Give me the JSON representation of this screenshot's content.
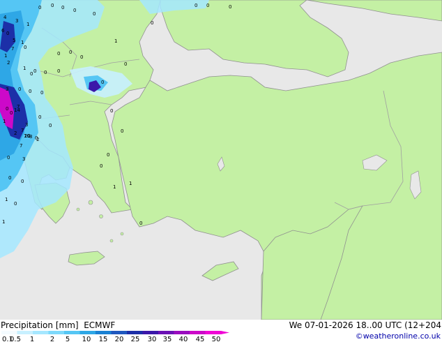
{
  "title": {
    "product": "Precipitation [mm]",
    "model": "ECMWF",
    "datetime": "We 07-01-2026 18..00 UTC (12+204"
  },
  "credit": "©weatheronline.co.uk",
  "legend": {
    "labels": [
      "0.1",
      "0.5",
      "1",
      "2",
      "5",
      "10",
      "15",
      "20",
      "25",
      "30",
      "35",
      "40",
      "45",
      "50"
    ],
    "colors": [
      "#f4fbff",
      "#c8f0ff",
      "#a5e7ff",
      "#7dd9fb",
      "#55c6f4",
      "#2ea7e6",
      "#1a81d3",
      "#1f58bf",
      "#1c2fa8",
      "#3b17a9",
      "#6c12b5",
      "#9a0cbf",
      "#cc09c9",
      "#f005d5"
    ]
  },
  "map": {
    "colors": {
      "sea": "#e8e8e8",
      "land": "#c4f0a4",
      "border": "#a0a0a0",
      "coast": "#909090"
    },
    "point_values": [
      "4",
      "3",
      "1",
      "0",
      "6",
      "5",
      "1",
      "7",
      "1",
      "2",
      "0",
      "0",
      "1",
      "0",
      "0",
      "0",
      "3",
      "0",
      "0",
      "0",
      "7",
      "0",
      "0",
      "1",
      "3",
      "7",
      "2",
      "0",
      "14",
      "0",
      "8",
      "16",
      "0",
      "7",
      "0",
      "3",
      "22",
      "2",
      "0",
      "0",
      "1",
      "0",
      "1",
      "0",
      "0",
      "0",
      "0",
      "0",
      "0",
      "0",
      "0",
      "1",
      "0",
      "0",
      "0",
      "0",
      "0",
      "0",
      "0",
      "0",
      "0",
      "1",
      "1",
      "0",
      "0"
    ]
  }
}
